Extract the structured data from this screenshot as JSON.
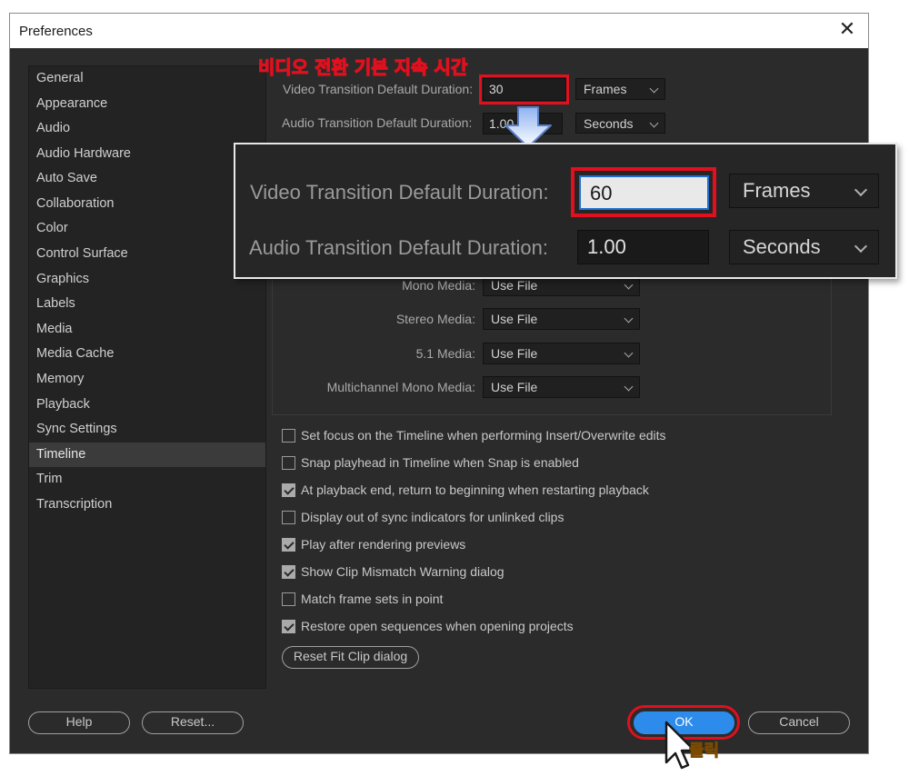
{
  "window": {
    "title": "Preferences",
    "close_glyph": "✕"
  },
  "sidebar": {
    "items": [
      {
        "label": "General"
      },
      {
        "label": "Appearance"
      },
      {
        "label": "Audio"
      },
      {
        "label": "Audio Hardware"
      },
      {
        "label": "Auto Save"
      },
      {
        "label": "Collaboration"
      },
      {
        "label": "Color"
      },
      {
        "label": "Control Surface"
      },
      {
        "label": "Graphics"
      },
      {
        "label": "Labels"
      },
      {
        "label": "Media"
      },
      {
        "label": "Media Cache"
      },
      {
        "label": "Memory"
      },
      {
        "label": "Playback"
      },
      {
        "label": "Sync Settings"
      },
      {
        "label": "Timeline"
      },
      {
        "label": "Trim"
      },
      {
        "label": "Transcription"
      }
    ],
    "selected": "Timeline"
  },
  "timeline": {
    "video_label": "Video Transition Default Duration:",
    "video_value": "30",
    "video_unit": "Frames",
    "audio_label": "Audio Transition Default Duration:",
    "audio_value": "1.00",
    "audio_unit": "Seconds",
    "media": [
      {
        "label": "Mono Media:",
        "value": "Use File"
      },
      {
        "label": "Stereo Media:",
        "value": "Use File"
      },
      {
        "label": "5.1 Media:",
        "value": "Use File"
      },
      {
        "label": "Multichannel Mono Media:",
        "value": "Use File"
      }
    ],
    "checkboxes": [
      {
        "label": "Set focus on the Timeline when performing Insert/Overwrite edits",
        "checked": false
      },
      {
        "label": "Snap playhead in Timeline when Snap is enabled",
        "checked": false
      },
      {
        "label": "At playback end, return to beginning when restarting playback",
        "checked": true
      },
      {
        "label": "Display out of sync indicators for unlinked clips",
        "checked": false
      },
      {
        "label": "Play after rendering previews",
        "checked": true
      },
      {
        "label": "Show Clip Mismatch Warning dialog",
        "checked": true
      },
      {
        "label": "Match frame sets in point",
        "checked": false
      },
      {
        "label": "Restore open sequences when opening projects",
        "checked": true
      }
    ],
    "reset_fit_clip": "Reset Fit Clip dialog"
  },
  "zoom": {
    "video_label": "Video Transition Default Duration:",
    "video_value": "60",
    "video_unit": "Frames",
    "audio_label": "Audio Transition Default Duration:",
    "audio_value": "1.00",
    "audio_unit": "Seconds"
  },
  "footer": {
    "help": "Help",
    "reset": "Reset...",
    "ok": "OK",
    "cancel": "Cancel"
  },
  "annotations": {
    "top": "비디오 전환 기본 지속 시간",
    "click": "클릭"
  },
  "colors": {
    "ok_blue": "#2d8ceb",
    "highlight_red": "#e0101e",
    "annot_yellow": "#f5c518"
  }
}
